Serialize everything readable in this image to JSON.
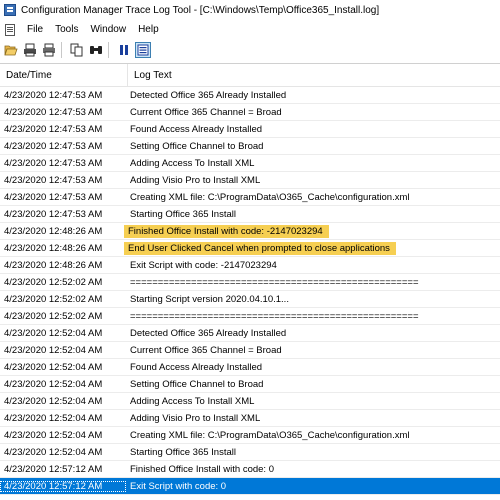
{
  "window": {
    "title": "Configuration Manager Trace Log Tool - [C:\\Windows\\Temp\\Office365_Install.log]"
  },
  "menu": {
    "items": [
      "File",
      "Tools",
      "Window",
      "Help"
    ]
  },
  "toolbar": {
    "buttons": [
      {
        "icon": "open-folder-icon"
      },
      {
        "icon": "print-preview-icon"
      },
      {
        "icon": "print-icon"
      },
      {
        "icon": "copy-icon"
      },
      {
        "icon": "find-icon"
      },
      {
        "icon": "pause-icon"
      },
      {
        "icon": "highlight-icon",
        "active": true
      }
    ]
  },
  "colors": {
    "highlight": "#f6cf52",
    "selection": "#0078d7"
  },
  "table": {
    "columns": [
      "Date/Time",
      "Log Text"
    ],
    "rows": [
      {
        "date": "4/23/2020 12:47:53 AM",
        "text": "Detected Office 365 Already Installed"
      },
      {
        "date": "4/23/2020 12:47:53 AM",
        "text": "Current Office 365 Channel = Broad"
      },
      {
        "date": "4/23/2020 12:47:53 AM",
        "text": "Found Access Already Installed"
      },
      {
        "date": "4/23/2020 12:47:53 AM",
        "text": "Setting Office Channel to Broad"
      },
      {
        "date": "4/23/2020 12:47:53 AM",
        "text": "Adding Access To Install XML"
      },
      {
        "date": "4/23/2020 12:47:53 AM",
        "text": "Adding Visio Pro to Install XML"
      },
      {
        "date": "4/23/2020 12:47:53 AM",
        "text": "Creating XML file: C:\\ProgramData\\O365_Cache\\configuration.xml"
      },
      {
        "date": "4/23/2020 12:47:53 AM",
        "text": "Starting Office 365 Install"
      },
      {
        "date": "4/23/2020 12:48:26 AM",
        "text": "Finished Office Install with code: -2147023294",
        "highlight": true
      },
      {
        "date": "4/23/2020 12:48:26 AM",
        "text": "End User Clicked Cancel when prompted to close applications",
        "highlight": true
      },
      {
        "date": "4/23/2020 12:48:26 AM",
        "text": "Exit Script with code: -2147023294"
      },
      {
        "date": "4/23/2020 12:52:02 AM",
        "text": "===================================================="
      },
      {
        "date": "4/23/2020 12:52:02 AM",
        "text": "Starting Script version 2020.04.10.1..."
      },
      {
        "date": "4/23/2020 12:52:02 AM",
        "text": "===================================================="
      },
      {
        "date": "4/23/2020 12:52:04 AM",
        "text": "Detected Office 365 Already Installed"
      },
      {
        "date": "4/23/2020 12:52:04 AM",
        "text": "Current Office 365 Channel = Broad"
      },
      {
        "date": "4/23/2020 12:52:04 AM",
        "text": "Found Access Already Installed"
      },
      {
        "date": "4/23/2020 12:52:04 AM",
        "text": "Setting Office Channel to Broad"
      },
      {
        "date": "4/23/2020 12:52:04 AM",
        "text": "Adding Access To Install XML"
      },
      {
        "date": "4/23/2020 12:52:04 AM",
        "text": "Adding Visio Pro to Install XML"
      },
      {
        "date": "4/23/2020 12:52:04 AM",
        "text": "Creating XML file: C:\\ProgramData\\O365_Cache\\configuration.xml"
      },
      {
        "date": "4/23/2020 12:52:04 AM",
        "text": "Starting Office 365 Install"
      },
      {
        "date": "4/23/2020 12:57:12 AM",
        "text": "Finished Office Install with code: 0"
      },
      {
        "date": "4/23/2020 12:57:12 AM",
        "text": "Exit Script with code: 0",
        "selected": true
      }
    ]
  }
}
